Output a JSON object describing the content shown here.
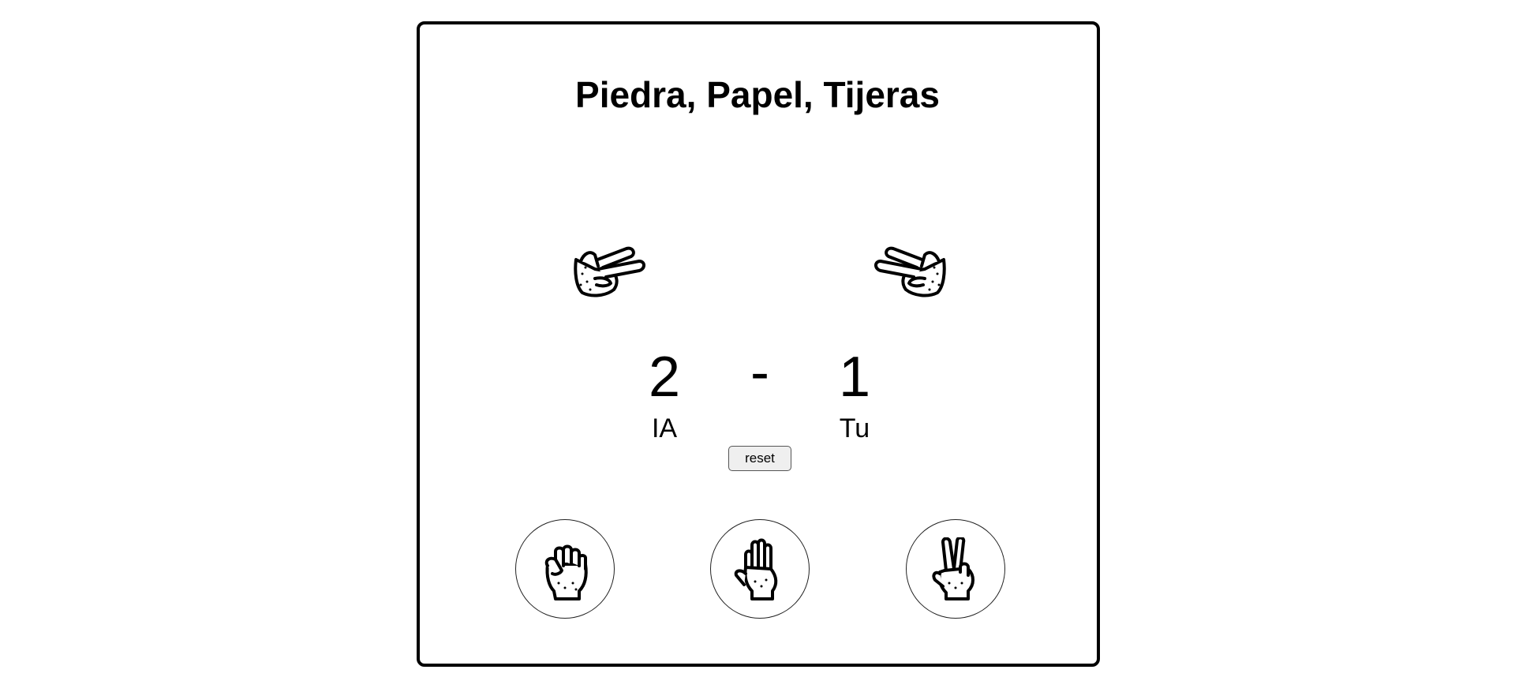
{
  "title": "Piedra, Papel, Tijeras",
  "ai_hand": {
    "icon": "scissors-hand-icon"
  },
  "player_hand": {
    "icon": "scissors-hand-icon"
  },
  "score": {
    "ai": "2",
    "separator": "-",
    "player": "1",
    "ai_label": "IA",
    "player_label": "Tu"
  },
  "reset_label": "reset",
  "choices": [
    {
      "name": "Piedra",
      "icon": "rock-fist-icon"
    },
    {
      "name": "Papel",
      "icon": "paper-hand-icon"
    },
    {
      "name": "Tijeras",
      "icon": "scissors-hand-icon"
    }
  ]
}
